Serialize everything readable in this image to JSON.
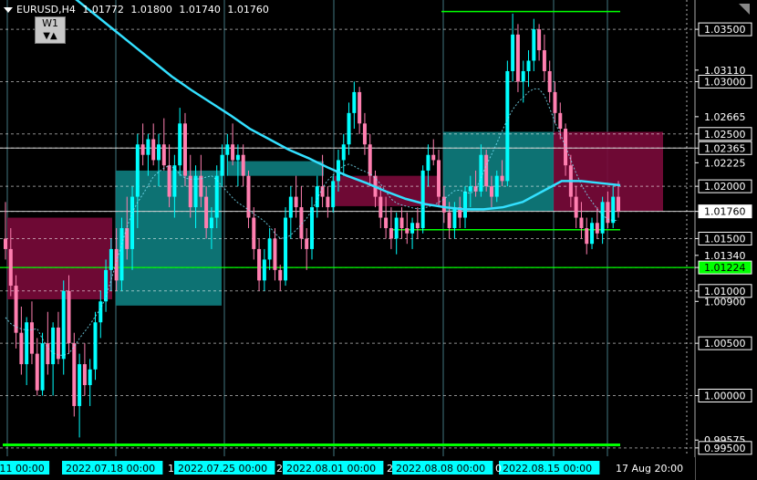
{
  "symbol": "EURUSD,H4",
  "ohlc": [
    "1.01772",
    "1.01800",
    "1.01740",
    "1.01760"
  ],
  "timeframe_button": "W1",
  "colors": {
    "background": "#000000",
    "price_label_bg": "#ffffff",
    "current_price_bg": "#ffffff",
    "highlight_label_bg": "#00ff00",
    "bull_candle": "#00ffff",
    "bear_candle": "#ff7fb0",
    "green_line": "#00ff00",
    "ma_line": "#33e0ff",
    "maroon_box": "#7a0a3a",
    "teal_box": "#0e7e80",
    "time_label_bg": "#00ffff"
  },
  "price_axis": {
    "labels": [
      "1.03500",
      "1.03110",
      "1.03000",
      "1.02665",
      "1.02500",
      "1.02365",
      "1.02225",
      "1.02000",
      "1.01760",
      "1.01500",
      "1.01340",
      "1.01224",
      "1.01000",
      "1.00900",
      "1.00500",
      "1.00000",
      "0.99575",
      "0.99500"
    ],
    "boxed": [
      "1.03500",
      "1.03000",
      "1.02500",
      "1.02365",
      "1.02000",
      "1.01760",
      "1.01500",
      "1.01224",
      "1.01000",
      "1.00500",
      "1.00000",
      "0.99500"
    ],
    "current_price": "1.01760",
    "green_price": "1.01224"
  },
  "time_axis": {
    "labels": [
      ".11 00:00",
      "2022.07.18 00:00",
      "2022.07.25 00:00",
      "2022.08.01 00:00",
      "2022.08.08 00:00",
      "2022.08.15 00:00"
    ],
    "fragments": [
      "1",
      "2",
      "2",
      "0"
    ],
    "current_label": "17 Aug 20:00"
  },
  "chart_data": {
    "type": "candlestick",
    "ylim": [
      0.9942,
      1.0378
    ],
    "candles": [
      [
        1.015,
        1.0185,
        1.013,
        1.014
      ],
      [
        1.014,
        1.016,
        1.0095,
        1.0105
      ],
      [
        1.0105,
        1.0115,
        1.0045,
        1.006
      ],
      [
        1.006,
        1.0085,
        1.002,
        1.003
      ],
      [
        1.003,
        1.0075,
        1.001,
        1.007
      ],
      [
        1.007,
        1.009,
        1.003,
        1.004
      ],
      [
        1.004,
        1.0055,
        1.0,
        1.0005
      ],
      [
        1.0005,
        1.006,
        1.0,
        1.005
      ],
      [
        1.005,
        1.008,
        1.002,
        1.003
      ],
      [
        1.003,
        1.007,
        1.0,
        1.0065
      ],
      [
        1.0065,
        1.008,
        1.003,
        1.0035
      ],
      [
        1.0035,
        1.011,
        1.002,
        1.01
      ],
      [
        1.01,
        1.0115,
        1.004,
        1.005
      ],
      [
        1.005,
        1.006,
        0.998,
        0.999
      ],
      [
        0.999,
        1.004,
        0.996,
        1.003
      ],
      [
        1.003,
        1.005,
        1.0,
        1.001
      ],
      [
        1.001,
        1.0035,
        0.999,
        1.0025
      ],
      [
        1.0025,
        1.008,
        1.0015,
        1.007
      ],
      [
        1.007,
        1.01,
        1.0055,
        1.009
      ],
      [
        1.009,
        1.013,
        1.008,
        1.012
      ],
      [
        1.012,
        1.015,
        1.01,
        1.014
      ],
      [
        1.014,
        1.016,
        1.01,
        1.011
      ],
      [
        1.011,
        1.017,
        1.01,
        1.016
      ],
      [
        1.016,
        1.019,
        1.013,
        1.014
      ],
      [
        1.014,
        1.02,
        1.012,
        1.019
      ],
      [
        1.019,
        1.025,
        1.016,
        1.024
      ],
      [
        1.024,
        1.026,
        1.022,
        1.023
      ],
      [
        1.023,
        1.025,
        1.021,
        1.0245
      ],
      [
        1.0245,
        1.026,
        1.022,
        1.0225
      ],
      [
        1.0225,
        1.025,
        1.02,
        1.024
      ],
      [
        1.024,
        1.0265,
        1.0215,
        1.022
      ],
      [
        1.022,
        1.024,
        1.018,
        1.019
      ],
      [
        1.019,
        1.023,
        1.017,
        1.022
      ],
      [
        1.022,
        1.0275,
        1.021,
        1.026
      ],
      [
        1.026,
        1.027,
        1.02,
        1.021
      ],
      [
        1.021,
        1.023,
        1.017,
        1.018
      ],
      [
        1.018,
        1.022,
        1.016,
        1.021
      ],
      [
        1.021,
        1.023,
        1.018,
        1.019
      ],
      [
        1.019,
        1.02,
        1.015,
        1.016
      ],
      [
        1.016,
        1.018,
        1.014,
        1.017
      ],
      [
        1.017,
        1.022,
        1.016,
        1.021
      ],
      [
        1.021,
        1.024,
        1.02,
        1.023
      ],
      [
        1.023,
        1.025,
        1.021,
        1.024
      ],
      [
        1.024,
        1.026,
        1.022,
        1.0225
      ],
      [
        1.0225,
        1.024,
        1.02,
        1.023
      ],
      [
        1.023,
        1.024,
        1.02,
        1.021
      ],
      [
        1.021,
        1.0215,
        1.016,
        1.017
      ],
      [
        1.017,
        1.018,
        1.013,
        1.014
      ],
      [
        1.014,
        1.015,
        1.01,
        1.011
      ],
      [
        1.011,
        1.014,
        1.01,
        1.013
      ],
      [
        1.013,
        1.016,
        1.012,
        1.015
      ],
      [
        1.015,
        1.016,
        1.011,
        1.012
      ],
      [
        1.012,
        1.0125,
        1.01,
        1.011
      ],
      [
        1.011,
        1.018,
        1.0105,
        1.017
      ],
      [
        1.017,
        1.02,
        1.015,
        1.019
      ],
      [
        1.019,
        1.021,
        1.017,
        1.018
      ],
      [
        1.018,
        1.02,
        1.014,
        1.015
      ],
      [
        1.015,
        1.016,
        1.012,
        1.014
      ],
      [
        1.014,
        1.019,
        1.013,
        1.018
      ],
      [
        1.018,
        1.021,
        1.017,
        1.02
      ],
      [
        1.02,
        1.023,
        1.018,
        1.019
      ],
      [
        1.019,
        1.02,
        1.017,
        1.018
      ],
      [
        1.018,
        1.021,
        1.0175,
        1.0205
      ],
      [
        1.0205,
        1.0235,
        1.0195,
        1.0225
      ],
      [
        1.0225,
        1.025,
        1.021,
        1.024
      ],
      [
        1.024,
        1.028,
        1.023,
        1.027
      ],
      [
        1.027,
        1.03,
        1.0255,
        1.029
      ],
      [
        1.029,
        1.0295,
        1.025,
        1.026
      ],
      [
        1.026,
        1.027,
        1.023,
        1.024
      ],
      [
        1.024,
        1.025,
        1.02,
        1.021
      ],
      [
        1.021,
        1.0215,
        1.018,
        1.019
      ],
      [
        1.019,
        1.02,
        1.016,
        1.017
      ],
      [
        1.017,
        1.019,
        1.015,
        1.016
      ],
      [
        1.016,
        1.018,
        1.014,
        1.015
      ],
      [
        1.015,
        1.0175,
        1.0135,
        1.017
      ],
      [
        1.017,
        1.018,
        1.015,
        1.016
      ],
      [
        1.016,
        1.0175,
        1.0145,
        1.0155
      ],
      [
        1.0155,
        1.017,
        1.014,
        1.0165
      ],
      [
        1.0165,
        1.018,
        1.015,
        1.016
      ],
      [
        1.016,
        1.022,
        1.0155,
        1.0215
      ],
      [
        1.0215,
        1.024,
        1.02,
        1.023
      ],
      [
        1.023,
        1.0245,
        1.022,
        1.0225
      ],
      [
        1.0225,
        1.0235,
        1.018,
        1.019
      ],
      [
        1.019,
        1.02,
        1.0165,
        1.0175
      ],
      [
        1.0175,
        1.0185,
        1.015,
        1.016
      ],
      [
        1.016,
        1.0185,
        1.015,
        1.018
      ],
      [
        1.018,
        1.019,
        1.016,
        1.017
      ],
      [
        1.017,
        1.02,
        1.016,
        1.0195
      ],
      [
        1.0195,
        1.021,
        1.018,
        1.02
      ],
      [
        1.02,
        1.0215,
        1.019,
        1.0195
      ],
      [
        1.0195,
        1.024,
        1.019,
        1.023
      ],
      [
        1.023,
        1.0235,
        1.0195,
        1.02
      ],
      [
        1.02,
        1.021,
        1.018,
        1.019
      ],
      [
        1.019,
        1.0215,
        1.0185,
        1.021
      ],
      [
        1.021,
        1.0225,
        1.02,
        1.0205
      ],
      [
        1.0205,
        1.032,
        1.02,
        1.031
      ],
      [
        1.031,
        1.0365,
        1.03,
        1.0345
      ],
      [
        1.0345,
        1.0355,
        1.029,
        1.03
      ],
      [
        1.03,
        1.032,
        1.028,
        1.031
      ],
      [
        1.031,
        1.033,
        1.0295,
        1.032
      ],
      [
        1.032,
        1.036,
        1.031,
        1.035
      ],
      [
        1.035,
        1.0355,
        1.032,
        1.033
      ],
      [
        1.033,
        1.0345,
        1.03,
        1.031
      ],
      [
        1.031,
        1.032,
        1.028,
        1.029
      ],
      [
        1.029,
        1.03,
        1.026,
        1.027
      ],
      [
        1.027,
        1.028,
        1.0245,
        1.0255
      ],
      [
        1.0255,
        1.026,
        1.021,
        1.022
      ],
      [
        1.022,
        1.023,
        1.018,
        1.019
      ],
      [
        1.019,
        1.02,
        1.016,
        1.017
      ],
      [
        1.017,
        1.0185,
        1.015,
        1.016
      ],
      [
        1.016,
        1.017,
        1.0135,
        1.0145
      ],
      [
        1.0145,
        1.017,
        1.014,
        1.0165
      ],
      [
        1.0165,
        1.018,
        1.015,
        1.0155
      ],
      [
        1.0155,
        1.019,
        1.0145,
        1.0185
      ],
      [
        1.0185,
        1.0195,
        1.016,
        1.0165
      ],
      [
        1.0165,
        1.02,
        1.016,
        1.019
      ],
      [
        1.019,
        1.0205,
        1.017,
        1.0176
      ]
    ],
    "ma": [
      1.0395,
      1.038,
      1.0365,
      1.035,
      1.0335,
      1.032,
      1.0305,
      1.0292,
      1.028,
      1.0268,
      1.0255,
      1.0245,
      1.0235,
      1.0227,
      1.0218,
      1.021,
      1.0203,
      1.0195,
      1.0188,
      1.0183,
      1.018,
      1.0178,
      1.0178,
      1.018,
      1.0185,
      1.0195,
      1.0205,
      1.0205,
      1.0203,
      1.0201
    ]
  }
}
